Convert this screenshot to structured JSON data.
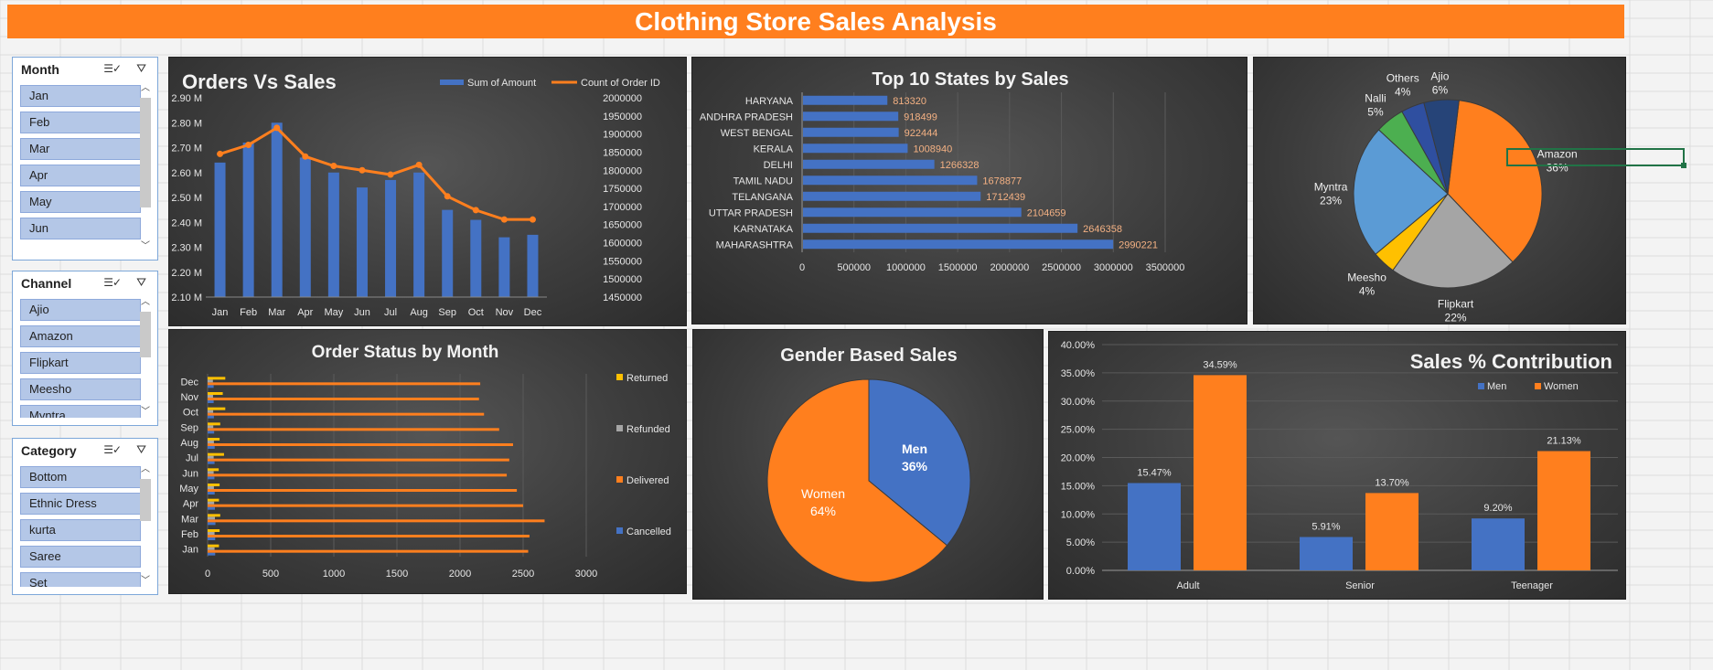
{
  "dashboard": {
    "title": "Clothing Store Sales Analysis"
  },
  "slicers": [
    {
      "title": "Month",
      "items": [
        "Jan",
        "Feb",
        "Mar",
        "Apr",
        "May",
        "Jun"
      ]
    },
    {
      "title": "Channel",
      "items": [
        "Ajio",
        "Amazon",
        "Flipkart",
        "Meesho",
        "Myntra"
      ]
    },
    {
      "title": "Category",
      "items": [
        "Bottom",
        "Ethnic Dress",
        "kurta",
        "Saree",
        "Set"
      ]
    }
  ],
  "icons": {
    "multi_select": "multi-select-icon",
    "clear_filter": "clear-filter-icon",
    "scroll_up": "chevron-up-icon",
    "scroll_down": "chevron-down-icon"
  },
  "colors": {
    "orange": "#ff7f1e",
    "blue": "#4472c4",
    "gray": "#a5a5a5",
    "yellow": "#ffc000",
    "green": "#4caf50",
    "light_blue": "#5b9bd5",
    "navy": "#2f4fa0",
    "dark_blue": "#264478"
  },
  "chart_data": [
    {
      "id": "orders_vs_sales",
      "type": "bar",
      "title": "Orders Vs Sales",
      "categories": [
        "Jan",
        "Feb",
        "Mar",
        "Apr",
        "May",
        "Jun",
        "Jul",
        "Aug",
        "Sep",
        "Oct",
        "Nov",
        "Dec"
      ],
      "series": [
        {
          "name": "Sum of Amount",
          "type": "bar",
          "axis": "left",
          "values": [
            2.64,
            2.72,
            2.8,
            2.66,
            2.6,
            2.54,
            2.57,
            2.6,
            2.45,
            2.41,
            2.34,
            2.35
          ]
        },
        {
          "name": "Count of Order ID",
          "type": "line",
          "axis": "right",
          "values": [
            1845000,
            1870000,
            1917000,
            1838000,
            1812000,
            1800000,
            1788000,
            1815000,
            1728000,
            1690000,
            1664000,
            1664000
          ]
        }
      ],
      "ylim": [
        2.1,
        2.9
      ],
      "yticks": [
        "2.90 M",
        "2.80 M",
        "2.70 M",
        "2.60 M",
        "2.50 M",
        "2.40 M",
        "2.30 M",
        "2.20 M",
        "2.10 M"
      ],
      "y2lim": [
        1450000,
        2000000
      ],
      "y2ticks": [
        "2000000",
        "1950000",
        "1900000",
        "1850000",
        "1800000",
        "1750000",
        "1700000",
        "1650000",
        "1600000",
        "1550000",
        "1500000",
        "1450000"
      ],
      "legend": "top-right"
    },
    {
      "id": "top_states",
      "type": "bar",
      "orientation": "horizontal",
      "title": "Top 10 States by Sales",
      "categories": [
        "HARYANA",
        "ANDHRA PRADESH",
        "WEST BENGAL",
        "KERALA",
        "DELHI",
        "TAMIL NADU",
        "TELANGANA",
        "UTTAR PRADESH",
        "KARNATAKA",
        "MAHARASHTRA"
      ],
      "values": [
        813320,
        918499,
        922444,
        1008940,
        1266328,
        1678877,
        1712439,
        2104659,
        2646358,
        2990221
      ],
      "data_labels": [
        "813320",
        "918499",
        "922444",
        "1008940",
        "1266328",
        "1678877",
        "1712439",
        "2104659",
        "2646358",
        "2990221"
      ],
      "xlim": [
        0,
        3500000
      ],
      "xticks": [
        "0",
        "500000",
        "1000000",
        "1500000",
        "2000000",
        "2500000",
        "3000000",
        "3500000"
      ]
    },
    {
      "id": "channel_share",
      "type": "pie",
      "labels": [
        "Amazon",
        "Flipkart",
        "Meesho",
        "Myntra",
        "Nalli",
        "Others",
        "Ajio"
      ],
      "values": [
        36,
        22,
        4,
        23,
        5,
        4,
        6
      ],
      "data_labels": [
        "36%",
        "22%",
        "4%",
        "23%",
        "5%",
        "4%",
        "6%"
      ]
    },
    {
      "id": "order_status",
      "type": "bar",
      "orientation": "horizontal",
      "stacked": false,
      "title": "Order Status by Month",
      "categories": [
        "Jan",
        "Feb",
        "Mar",
        "Apr",
        "May",
        "Jun",
        "Jul",
        "Aug",
        "Sep",
        "Oct",
        "Nov",
        "Dec"
      ],
      "series": [
        {
          "name": "Cancelled",
          "values": [
            60,
            60,
            62,
            58,
            56,
            54,
            55,
            56,
            52,
            50,
            48,
            48
          ]
        },
        {
          "name": "Delivered",
          "values": [
            2540,
            2550,
            2670,
            2500,
            2450,
            2370,
            2390,
            2420,
            2310,
            2190,
            2150,
            2160
          ]
        },
        {
          "name": "Refunded",
          "values": [
            55,
            55,
            58,
            52,
            50,
            48,
            48,
            50,
            45,
            44,
            43,
            42
          ]
        },
        {
          "name": "Returned",
          "values": [
            90,
            95,
            100,
            90,
            95,
            88,
            130,
            95,
            100,
            140,
            120,
            140
          ]
        }
      ],
      "legend_order": [
        "Returned",
        "Refunded",
        "Delivered",
        "Cancelled"
      ],
      "xlim": [
        0,
        3000
      ],
      "xticks": [
        "0",
        "500",
        "1000",
        "1500",
        "2000",
        "2500",
        "3000"
      ],
      "legend": "right"
    },
    {
      "id": "gender_sales",
      "type": "pie",
      "title": "Gender Based Sales",
      "labels": [
        "Men",
        "Women"
      ],
      "values": [
        36,
        64
      ],
      "data_labels": [
        "36%",
        "64%"
      ]
    },
    {
      "id": "sales_contribution",
      "type": "bar",
      "title": "Sales % Contribution",
      "categories": [
        "Adult",
        "Senior",
        "Teenager"
      ],
      "series": [
        {
          "name": "Men",
          "values": [
            15.47,
            5.91,
            9.2
          ],
          "labels": [
            "15.47%",
            "5.91%",
            "9.20%"
          ]
        },
        {
          "name": "Women",
          "values": [
            34.59,
            13.7,
            21.13
          ],
          "labels": [
            "34.59%",
            "13.70%",
            "21.13%"
          ]
        }
      ],
      "ylim": [
        0,
        40
      ],
      "yticks": [
        "40.00%",
        "35.00%",
        "30.00%",
        "25.00%",
        "20.00%",
        "15.00%",
        "10.00%",
        "5.00%",
        "0.00%"
      ],
      "legend": "top-right"
    }
  ]
}
